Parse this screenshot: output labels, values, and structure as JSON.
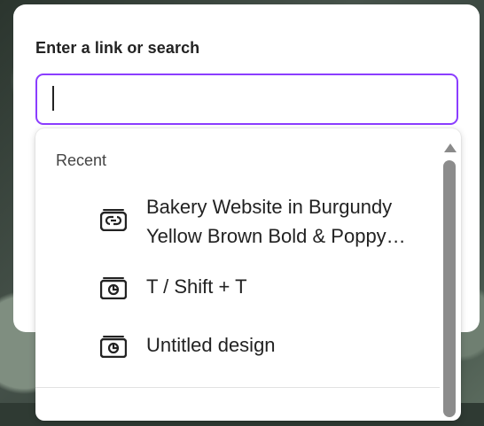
{
  "dialog": {
    "label": "Enter a link or search",
    "input_value": ""
  },
  "recent": {
    "title": "Recent",
    "items": [
      {
        "label": "Bakery Website in Burgundy Yellow Brown Bold & Poppy…",
        "icon": "website-design-icon"
      },
      {
        "label": "T / Shift + T",
        "icon": "design-icon"
      },
      {
        "label": "Untitled design",
        "icon": "design-icon"
      }
    ]
  },
  "colors": {
    "focus_border": "#8b3dff",
    "scrollbar": "#8c8c8c"
  }
}
